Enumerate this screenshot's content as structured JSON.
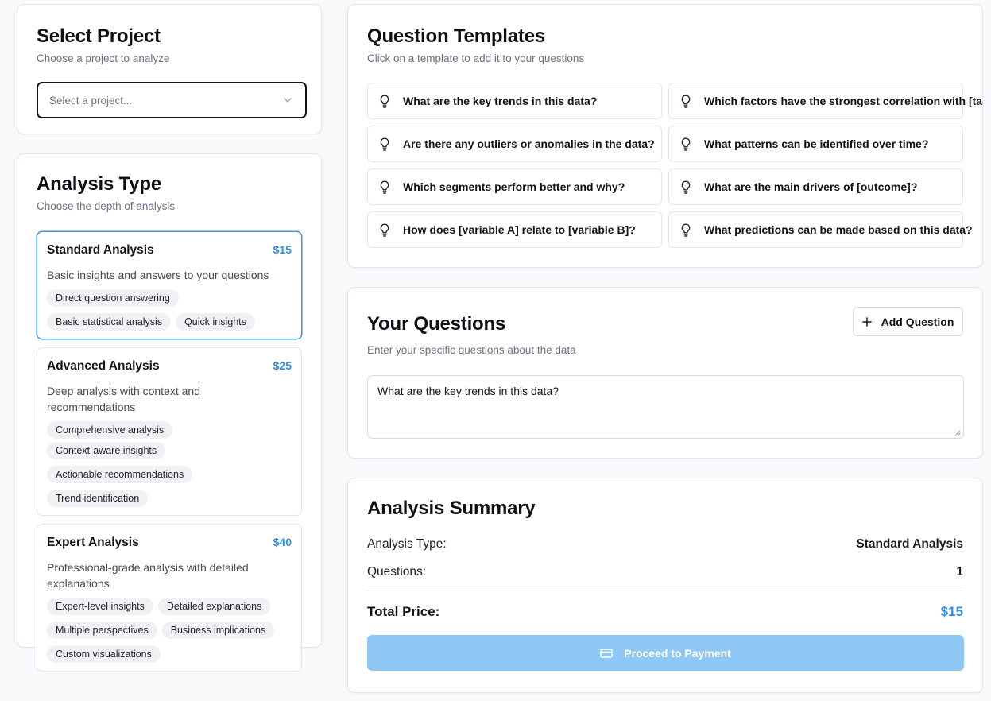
{
  "project": {
    "title": "Select Project",
    "subtitle": "Choose a project to analyze",
    "select_placeholder": "Select a project..."
  },
  "analysis": {
    "title": "Analysis Type",
    "subtitle": "Choose the depth of analysis",
    "options": [
      {
        "name": "Standard Analysis",
        "price": "$15",
        "description": "Basic insights and answers to your questions",
        "tags": [
          "Direct question answering",
          "Basic statistical analysis",
          "Quick insights"
        ]
      },
      {
        "name": "Advanced Analysis",
        "price": "$25",
        "description": "Deep analysis with context and recommendations",
        "tags": [
          "Comprehensive analysis",
          "Context-aware insights",
          "Actionable recommendations",
          "Trend identification"
        ]
      },
      {
        "name": "Expert Analysis",
        "price": "$40",
        "description": "Professional-grade analysis with detailed explanations",
        "tags": [
          "Expert-level insights",
          "Detailed explanations",
          "Multiple perspectives",
          "Business implications",
          "Custom visualizations"
        ]
      }
    ]
  },
  "templates": {
    "title": "Question Templates",
    "subtitle": "Click on a template to add it to your questions",
    "items": [
      "What are the key trends in this data?",
      "Which factors have the strongest correlation with [target]?",
      "Are there any outliers or anomalies in the data?",
      "What patterns can be identified over time?",
      "Which segments perform better and why?",
      "What are the main drivers of [outcome]?",
      "How does [variable A] relate to [variable B]?",
      "What predictions can be made based on this data?"
    ]
  },
  "questions": {
    "title": "Your Questions",
    "subtitle": "Enter your specific questions about the data",
    "add_label": "Add Question",
    "value": "What are the key trends in this data?"
  },
  "summary": {
    "title": "Analysis Summary",
    "type_label": "Analysis Type:",
    "type_value": "Standard Analysis",
    "questions_label": "Questions:",
    "questions_value": "1",
    "total_label": "Total Price:",
    "total_value": "$15",
    "pay_label": "Proceed to Payment"
  },
  "colors": {
    "accent": "#2d8fe0",
    "pay_button_disabled": "#90c8f5",
    "selected_border": "#3b95dc"
  }
}
